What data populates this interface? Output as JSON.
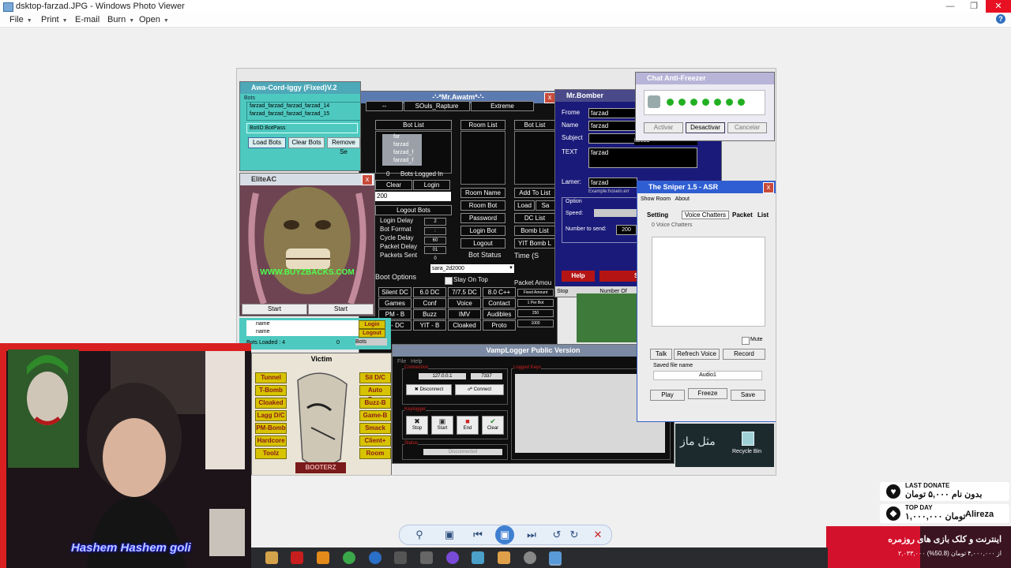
{
  "window": {
    "title": "dsktop-farzad.JPG - Windows Photo Viewer",
    "minimize_icon": "minimize-icon",
    "restore_icon": "restore-icon",
    "close_icon": "close-icon"
  },
  "menu": {
    "items": [
      {
        "label": "File",
        "has_arrow": true
      },
      {
        "label": "Print",
        "has_arrow": true
      },
      {
        "label": "E-mail",
        "has_arrow": false
      },
      {
        "label": "Burn",
        "has_arrow": true
      },
      {
        "label": "Open",
        "has_arrow": true
      }
    ],
    "help_icon": "help-icon"
  },
  "shot": {
    "awa": {
      "title": "Awa-Cord-Iggy (Fixed)V.2",
      "bots_label": "Bots",
      "list": [
        "farzad_farzad_farzad_farzad_14",
        "farzad_farzad_farzad_farzad_15"
      ],
      "botid_value": "BotID:BotPass",
      "buttons": [
        "Load Bots",
        "Clear Bots",
        "Remove Se"
      ]
    },
    "awatm": {
      "title": "-'-*Mr.Awatm*-'-",
      "tabs": [
        "--",
        "SOuls_Rapture",
        "Extreme"
      ],
      "col1": {
        "bot_list": "Bot List",
        "list_items": [
          "far",
          "farzad",
          "farzad_f",
          "farzad_f"
        ],
        "bots_logged_count": "0",
        "bots_logged_label": "Bots Logged In",
        "clear": "Clear",
        "login": "Login",
        "select_value": "200",
        "logout_bots": "Logout Bots",
        "fields": [
          {
            "label": "Login Delay",
            "value": "2"
          },
          {
            "label": "Bot Format",
            "value": ":"
          },
          {
            "label": "Cycle Delay",
            "value": "60"
          },
          {
            "label": "Packet Delay",
            "value": "01"
          },
          {
            "label": "Packets Sent",
            "value": "0"
          }
        ],
        "boot_options": "Boot Options"
      },
      "col2": {
        "room_list": "Room List",
        "buttons": [
          "Room Name",
          "Room Bot",
          "Password",
          "Login Bot",
          "Logout"
        ],
        "bot_status": "Bot Status",
        "select_value": "sara_2d2000",
        "stay_on_top": "Stay On Top"
      },
      "col3": {
        "bot_list": "Bot List",
        "buttons": [
          "Add To List",
          "Load",
          "Sa",
          "DC List",
          "Bomb List",
          "YIT Bomb L"
        ],
        "time": "Time (S",
        "packet_amount": "Packet Amou"
      },
      "grid": [
        [
          "Silent DC",
          "6.0 DC",
          "7/7.5 DC",
          "8.0 C++"
        ],
        [
          "Games",
          "Conf",
          "Voice",
          "Contact"
        ],
        [
          "PM - B",
          "Buzz",
          "IMV",
          "Audibles"
        ],
        [
          "T - DC",
          "YIT - B",
          "Cloaked",
          "Proto"
        ]
      ],
      "right_mini": [
        "Fixed Amount",
        "1 Per Bot",
        "250",
        "1000"
      ]
    },
    "bomber": {
      "title": "Mr.Bomber",
      "fields": [
        {
          "label": "Frome",
          "value": "farzad"
        },
        {
          "label": "Name",
          "value": "farzad"
        },
        {
          "label": "Subject",
          "value": ""
        },
        {
          "label": "TEXT",
          "value": "farzad"
        }
      ],
      "subject_side": "farzad",
      "lamer_label": "Lamer:",
      "lamer_value": "farzad",
      "example": "Example:hosein.err",
      "option": "Option",
      "speed": "Speed:",
      "number_to_send": "Number to send:",
      "number_value": "200",
      "help": "Help",
      "start": "St",
      "stop": "Stop",
      "number_of": "Number Of"
    },
    "freezer": {
      "title": "Chat Anti-Freezer",
      "buttons": [
        "Activar",
        "Desactivar",
        "Cancelar"
      ],
      "dots": 7,
      "dot_color": "#22b022"
    },
    "eliteac": {
      "title": "EliteAC",
      "watermark": "WWW.BUYZBACKS.COM",
      "buttons": [
        "Start",
        "Start"
      ]
    },
    "small": {
      "list": [
        "name",
        "name"
      ],
      "login": "Login",
      "logout": "Logout",
      "loaded": "Bots Loaded : 4",
      "loaded_count": "0",
      "bots": "Bots"
    },
    "victim": {
      "title": "Victim",
      "left": [
        "Tunnel",
        "T-Bomb",
        "Cloaked",
        "Lagg D/C",
        "PM-Bomb",
        "Hardcore",
        "Toolz"
      ],
      "right": [
        "Sil D/C",
        "Auto Boot",
        "Buzz-B",
        "Game-B",
        "Smack",
        "Client+",
        "Room"
      ],
      "logo": "BOOTERZ"
    },
    "vamp": {
      "title": "VampLogger Public Version",
      "menu": [
        "File",
        "Help"
      ],
      "connection": "Connection",
      "ip": "127.0.0.1",
      "port": "7337",
      "disconnect": "Disconnect",
      "connect": "Connect",
      "keylogger": "Keylogger",
      "key_buttons": [
        "Stop",
        "Start",
        "End",
        "Clear"
      ],
      "logged_keys": "Logged Keys",
      "status_label": "Status",
      "status": "Disconnected"
    },
    "sniper": {
      "title": "The Sniper 1.5    -    ASR",
      "menu": [
        "Show Room",
        "About"
      ],
      "tabs": [
        "Setting",
        "Voice Chatters",
        "Packet",
        "List"
      ],
      "voice_chatters": "0 Voice Chatters",
      "mute": "Mute",
      "buttons": [
        "Talk",
        "Refrech Voice",
        "Record"
      ],
      "saved_file_name": "Saved file name",
      "file_value": "Audio1",
      "bottom": [
        "Play",
        "Freeze",
        "Save"
      ]
    },
    "desktop": {
      "arabic": "مثل ماز",
      "recycle": "Recycle Bin"
    }
  },
  "webcam": {
    "name": "Hashem Hashem goli"
  },
  "donate": {
    "last_donate_label": "LAST DONATE",
    "last_donate_text": "بدون نام ۵,۰۰۰ تومان",
    "top_day_label": "TOP DAY",
    "top_day_name": "Alireza",
    "top_day_amount": "۱,۰۰۰,۰۰۰ تومان",
    "goal_title": "اینترنت و کلک بازی های روزمره",
    "goal_text": "۲,۰۳۳,۰۰۰ از ۴,۰۰۰,۰۰۰ تومان (50.8%)",
    "goal_progress": 0.508
  },
  "viewer_toolbar": {
    "icons": [
      "zoom-icon",
      "actual-size-icon",
      "previous-icon",
      "slideshow-icon",
      "next-icon",
      "rotate-left-icon",
      "rotate-right-icon",
      "delete-icon"
    ]
  }
}
